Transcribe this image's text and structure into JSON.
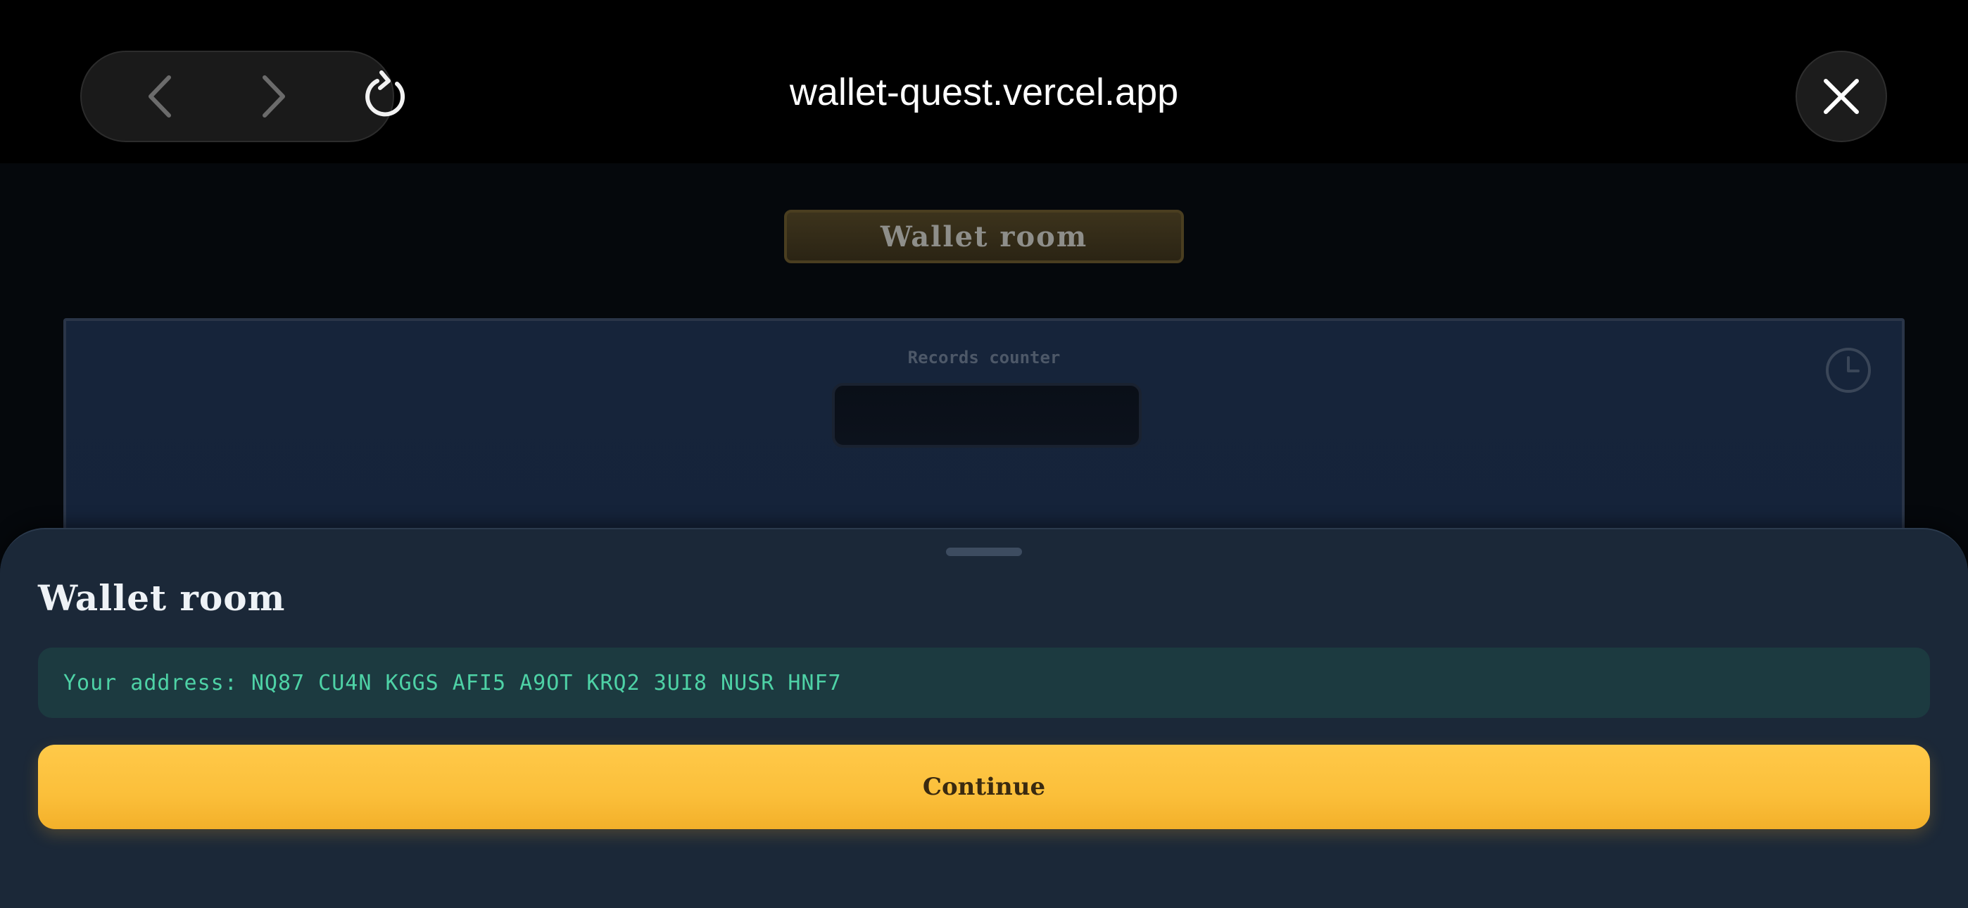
{
  "browser": {
    "url": "wallet-quest.vercel.app",
    "back_icon": "chevron-left-icon",
    "forward_icon": "chevron-right-icon",
    "reload_icon": "reload-icon",
    "close_icon": "close-icon"
  },
  "page": {
    "title": "Wallet room",
    "records_label": "Records counter",
    "records_value": "",
    "clock_icon": "clock-icon"
  },
  "sheet": {
    "title": "Wallet room",
    "address_text": "Your address: NQ87 CU4N KGGS AFI5 A9OT KRQ2 3UI8 NUSR HNF7",
    "continue_label": "Continue"
  },
  "colors": {
    "sheet_bg": "#1b2838",
    "address_bg": "#1c3a40",
    "address_text": "#4ed2a6",
    "accent": "#fbbf3a"
  }
}
